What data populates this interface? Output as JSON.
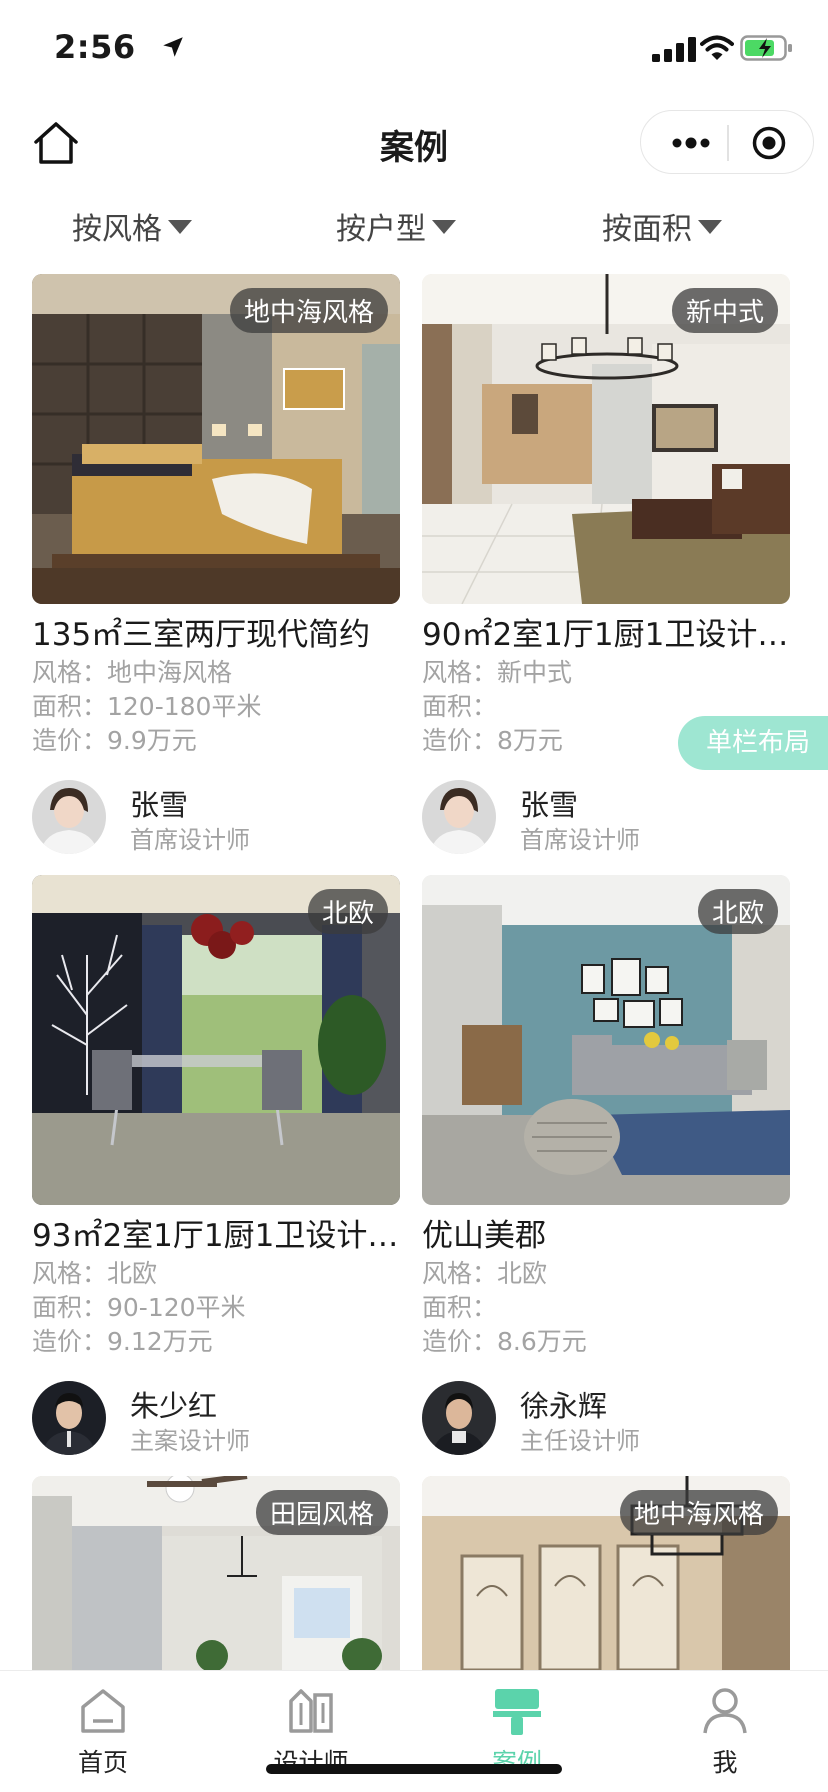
{
  "status_bar": {
    "time": "2:56"
  },
  "nav": {
    "title": "案例"
  },
  "filters": [
    {
      "label": "按风格"
    },
    {
      "label": "按户型"
    },
    {
      "label": "按面积"
    }
  ],
  "cards": [
    {
      "tag": "地中海风格",
      "title": "135㎡三室两厅现代简约",
      "style": "风格：地中海风格",
      "area": "面积：120-180平米",
      "price": "造价：9.9万元",
      "designer_name": "张雪",
      "designer_role": "首席设计师"
    },
    {
      "tag": "新中式",
      "title": "90㎡2室1厅1厨1卫设计…",
      "style": "风格：新中式",
      "area": "面积：",
      "price": "造价：8万元",
      "designer_name": "张雪",
      "designer_role": "首席设计师"
    },
    {
      "tag": "北欧",
      "title": "93㎡2室1厅1厨1卫设计…",
      "style": "风格：北欧",
      "area": "面积：90-120平米",
      "price": "造价：9.12万元",
      "designer_name": "朱少红",
      "designer_role": "主案设计师"
    },
    {
      "tag": "北欧",
      "title": "优山美郡",
      "style": "风格：北欧",
      "area": "面积：",
      "price": "造价：8.6万元",
      "designer_name": "徐永辉",
      "designer_role": "主任设计师"
    },
    {
      "tag": "田园风格"
    },
    {
      "tag": "地中海风格"
    }
  ],
  "layout_button": "单栏布局",
  "tabbar": [
    {
      "label": "首页",
      "icon": "home-icon"
    },
    {
      "label": "设计师",
      "icon": "designer-icon"
    },
    {
      "label": "案例",
      "icon": "case-icon"
    },
    {
      "label": "我",
      "icon": "profile-icon"
    }
  ],
  "colors": {
    "accent": "#5bd3ab",
    "tag_bg": "#3c3c3c",
    "layout_btn": "#9ee6d2"
  }
}
